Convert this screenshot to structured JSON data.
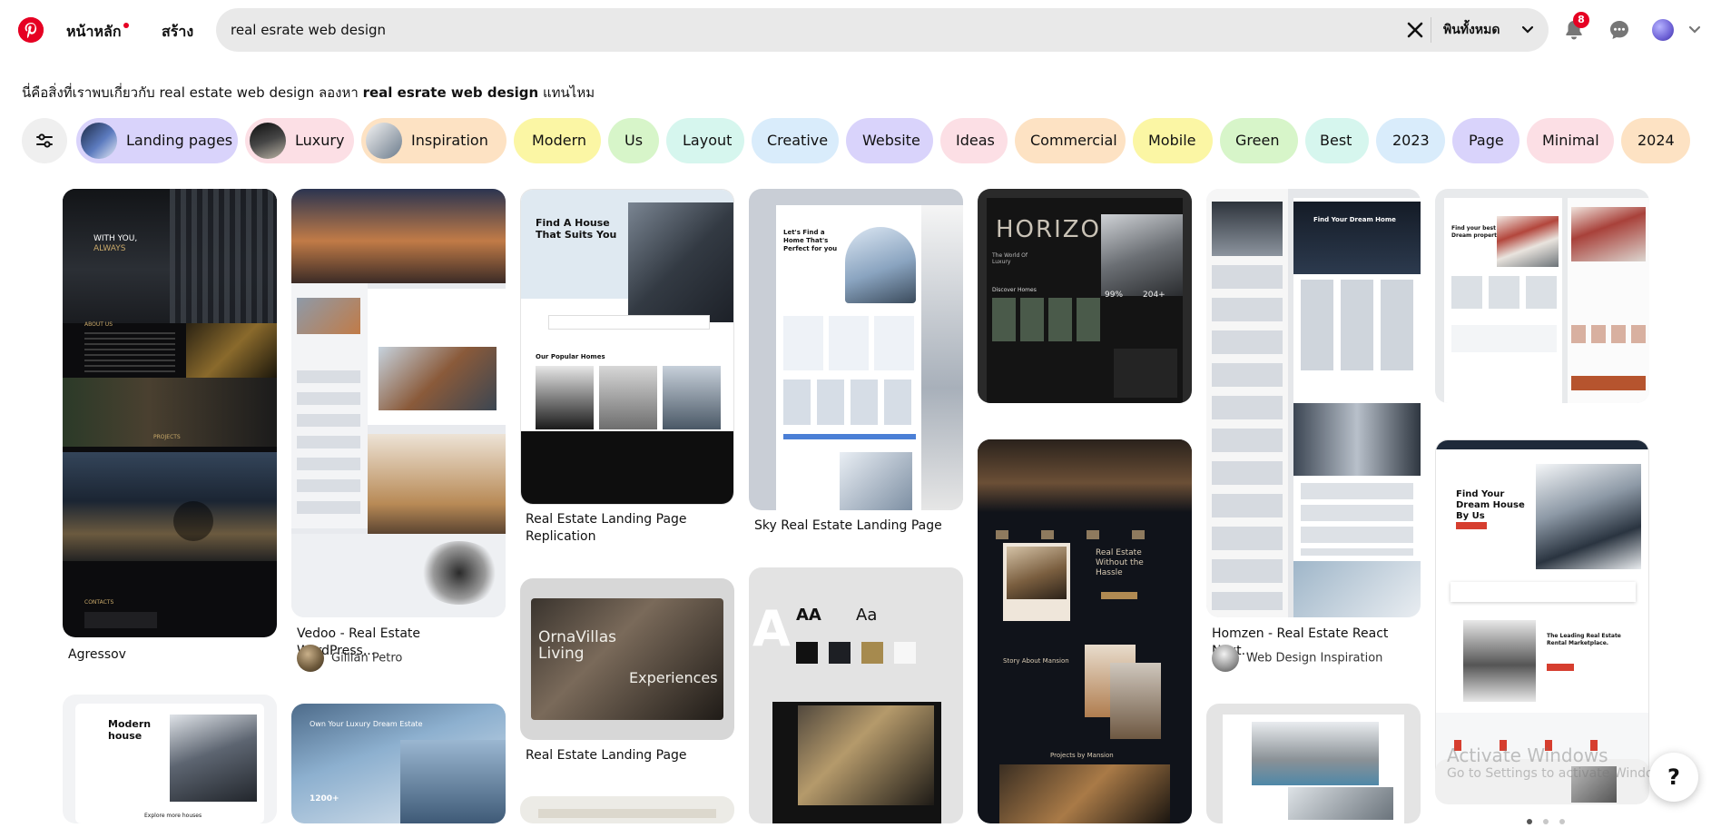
{
  "header": {
    "logo_icon": "pinterest-logo-icon",
    "nav_home": "หน้าหลัก",
    "nav_create": "สร้าง",
    "search_value": "real esrate web design",
    "search_scope": "พินทั้งหมด",
    "notifications_count": "8",
    "brand_color": "#e60023"
  },
  "suggestion": {
    "prefix": "นี่คือสิ่งที่เราพบเกี่ยวกับ real estate web design ลองหา ",
    "query": "real esrate web design",
    "suffix": " แทนไหม"
  },
  "chips": [
    {
      "label": "Landing pages",
      "color": "#d9d3fb"
    },
    {
      "label": "Luxury",
      "color": "#fcdfe5"
    },
    {
      "label": "Inspiration",
      "color": "#fde2c3"
    },
    {
      "label": "Modern",
      "color": "#fbf6a4"
    },
    {
      "label": "Us",
      "color": "#d7f5c9"
    },
    {
      "label": "Layout",
      "color": "#d6f6ee"
    },
    {
      "label": "Creative",
      "color": "#d9ecfb"
    },
    {
      "label": "Website",
      "color": "#d9d3fb"
    },
    {
      "label": "Ideas",
      "color": "#fcdfe5"
    },
    {
      "label": "Commercial",
      "color": "#fde2c3"
    },
    {
      "label": "Mobile",
      "color": "#fbf6a4"
    },
    {
      "label": "Green",
      "color": "#d7f5c9"
    },
    {
      "label": "Best",
      "color": "#d6f6ee"
    },
    {
      "label": "2023",
      "color": "#d9ecfb"
    },
    {
      "label": "Page",
      "color": "#d9d3fb"
    },
    {
      "label": "Minimal",
      "color": "#fcdfe5"
    },
    {
      "label": "2024",
      "color": "#fde2c3"
    }
  ],
  "pins": {
    "p1_title": "Agressov",
    "p2_title": "Vedoo - Real Estate WordPress...",
    "p2_author": "Gillian Petro",
    "p3_title": "Real Estate Landing Page Replication",
    "p4_title": "Real Estate Landing Page",
    "p5_title": "Sky Real Estate Landing Page",
    "p8_title": "Homzen - Real Estate React Next...",
    "p8_author": "Web Design Inspiration"
  },
  "pin_image_text": {
    "p1_with_you": "WITH YOU,",
    "p1_always": "ALWAYS",
    "p1_about": "ABOUT US",
    "p1_projects": "PROJECTS",
    "p1_contacts": "CONTACTS",
    "p3_headline": "Find A House That Suits You",
    "p3_popular": "Our Popular Homes",
    "p4_brand": "OrnaVillas Living",
    "p4_tag": "Experiences",
    "p5_headline": "Let's Find a Home That's Perfect for you",
    "p6_aa1": "AA",
    "p6_aa2": "Aa",
    "p7_horizon": "HORIZON",
    "p7_world": "The World Of Luxury",
    "p7_discover": "Discover Homes",
    "p7_stat1": "99%",
    "p7_stat2": "204+",
    "p8_dream": "Find Your Dream Home",
    "p9_dream": "Find your best Dream property",
    "p10_headline": "Find Your Dream House By Us",
    "p10_market": "The Leading Real Estate Rental Marketplace.",
    "p11_title": "Real Estate Without the Hassle",
    "p11_story": "Story About Mansion",
    "p11_projects": "Projects by Mansion",
    "p12_modern": "Modern house",
    "p12_explore": "Explore more houses",
    "p13_headline": "Own Your Luxury Dream Estate",
    "p13_count": "1200+"
  },
  "overlay": {
    "watermark_title": "Activate Windows",
    "watermark_sub": "Go to Settings to activate Windows.",
    "help_label": "?"
  }
}
